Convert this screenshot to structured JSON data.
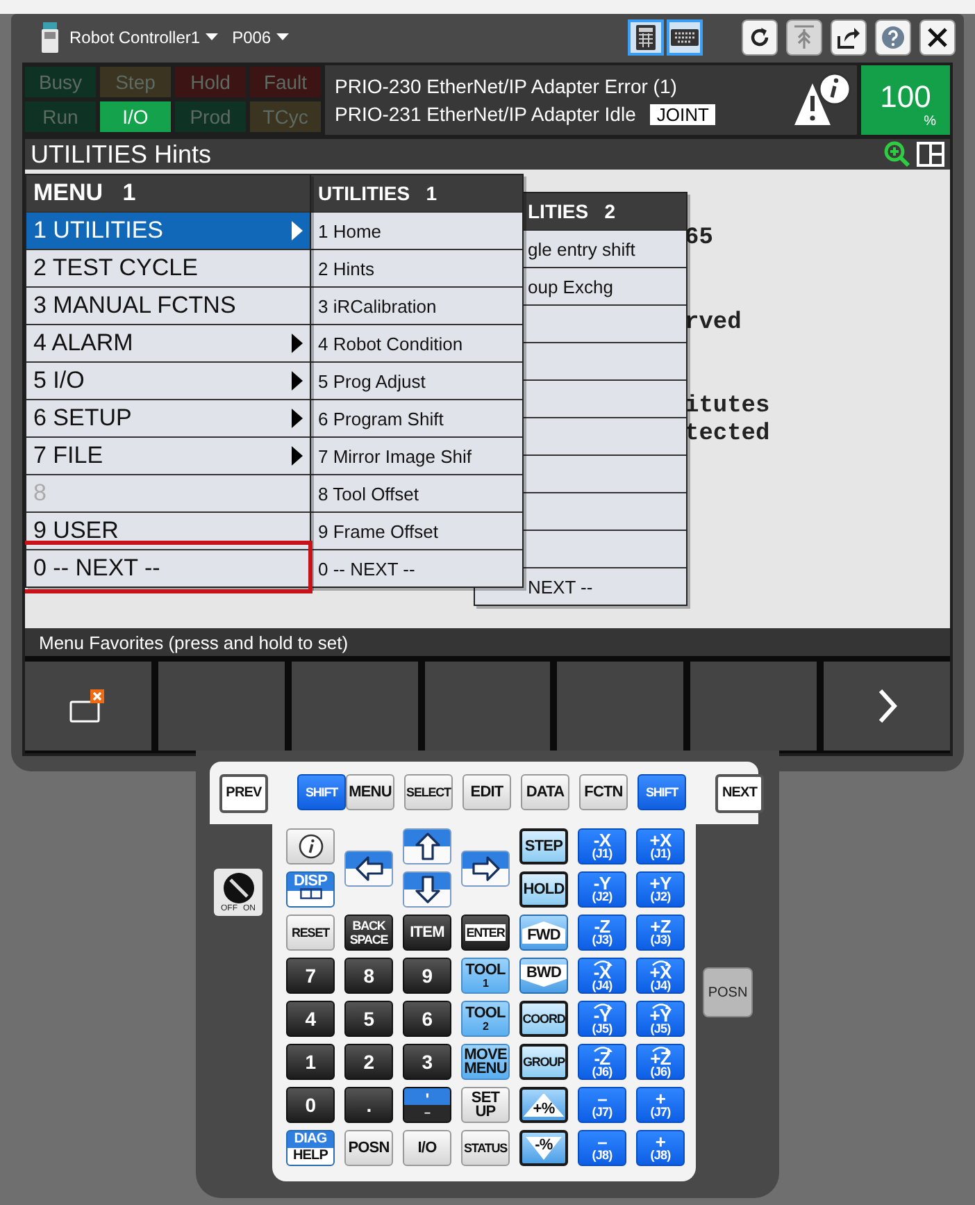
{
  "window": {
    "title": "Robot Controller1",
    "program": "P006"
  },
  "status_flags": [
    {
      "label": "Busy",
      "on": false,
      "color": "#0e3324"
    },
    {
      "label": "Step",
      "on": false,
      "color": "#3a3420"
    },
    {
      "label": "Hold",
      "on": false,
      "color": "#3d1414"
    },
    {
      "label": "Fault",
      "on": false,
      "color": "#3d1414"
    },
    {
      "label": "Run",
      "on": false,
      "color": "#0e3324"
    },
    {
      "label": "I/O",
      "on": true,
      "color": "#15a24c"
    },
    {
      "label": "Prod",
      "on": false,
      "color": "#0e3324"
    },
    {
      "label": "TCyc",
      "on": false,
      "color": "#3a3420"
    }
  ],
  "messages": [
    "PRIO-230 EtherNet/IP Adapter Error (1)",
    "PRIO-231 EtherNet/IP Adapter Idle"
  ],
  "coord_mode": "JOINT",
  "override": {
    "value": "100",
    "unit": "%"
  },
  "screen_title": "UTILITIES Hints",
  "background_lines": [
    "65",
    "rved",
    "itutes",
    "tected"
  ],
  "menus": [
    {
      "title": "MENU",
      "page": "1",
      "items": [
        {
          "label": "1 UTILITIES",
          "selected": true,
          "submenu": true,
          "disabled": false,
          "outlined": false
        },
        {
          "label": "2 TEST CYCLE",
          "selected": false,
          "submenu": false,
          "disabled": false,
          "outlined": false
        },
        {
          "label": "3 MANUAL FCTNS",
          "selected": false,
          "submenu": false,
          "disabled": false,
          "outlined": false
        },
        {
          "label": "4 ALARM",
          "selected": false,
          "submenu": true,
          "disabled": false,
          "outlined": false
        },
        {
          "label": "5 I/O",
          "selected": false,
          "submenu": true,
          "disabled": false,
          "outlined": false
        },
        {
          "label": "6 SETUP",
          "selected": false,
          "submenu": true,
          "disabled": false,
          "outlined": false
        },
        {
          "label": "7 FILE",
          "selected": false,
          "submenu": true,
          "disabled": false,
          "outlined": false
        },
        {
          "label": "8",
          "selected": false,
          "submenu": false,
          "disabled": true,
          "outlined": false
        },
        {
          "label": "9 USER",
          "selected": false,
          "submenu": false,
          "disabled": false,
          "outlined": false
        },
        {
          "label": "0 -- NEXT --",
          "selected": false,
          "submenu": false,
          "disabled": false,
          "outlined": true
        }
      ]
    },
    {
      "title": "UTILITIES",
      "page": "1",
      "items": [
        {
          "label": "1 Home"
        },
        {
          "label": "2 Hints"
        },
        {
          "label": "3 iRCalibration"
        },
        {
          "label": "4 Robot Condition"
        },
        {
          "label": "5 Prog Adjust"
        },
        {
          "label": "6 Program Shift"
        },
        {
          "label": "7 Mirror Image Shif"
        },
        {
          "label": "8 Tool Offset"
        },
        {
          "label": "9 Frame Offset"
        },
        {
          "label": "0 -- NEXT --"
        }
      ]
    },
    {
      "title": "LITIES",
      "page": "2",
      "items": [
        {
          "label": "gle entry shift"
        },
        {
          "label": "oup Exchg"
        },
        {
          "kind": "blank"
        },
        {
          "kind": "blank"
        },
        {
          "kind": "blank"
        },
        {
          "kind": "blank"
        },
        {
          "kind": "blank"
        },
        {
          "kind": "blank"
        },
        {
          "kind": "blank"
        },
        {
          "label": "NEXT --"
        }
      ]
    }
  ],
  "favorites_label": "Menu Favorites (press and hold to set)",
  "softkeys": [
    {
      "kind": "window_close"
    },
    {
      "kind": "blank"
    },
    {
      "kind": "blank"
    },
    {
      "kind": "blank"
    },
    {
      "kind": "blank"
    },
    {
      "kind": "blank"
    },
    {
      "kind": "next"
    }
  ],
  "keypad": {
    "top_keys": [
      {
        "label": "PREV",
        "kind": "side"
      },
      {
        "label": "SHIFT",
        "kind": "shift"
      },
      {
        "label": "MENU",
        "kind": "gray"
      },
      {
        "label": "SELECT",
        "kind": "gray"
      },
      {
        "label": "EDIT",
        "kind": "gray"
      },
      {
        "label": "DATA",
        "kind": "gray"
      },
      {
        "label": "FCTN",
        "kind": "gray"
      },
      {
        "label": "SHIFT",
        "kind": "shift"
      },
      {
        "label": "NEXT",
        "kind": "side"
      }
    ],
    "keys": [
      {
        "kind": "info"
      },
      {
        "kind": "arrow_left"
      },
      {
        "kind": "arrow_up"
      },
      {
        "kind": "arrow_right"
      },
      {
        "label": "STEP",
        "kind": "framed"
      },
      {
        "label": "-X",
        "sub": "(J1)",
        "kind": "jog"
      },
      {
        "label": "+X",
        "sub": "(J1)",
        "kind": "jog"
      },
      {
        "label": "DISP",
        "kind": "disp"
      },
      {
        "kind": "arrow_down"
      },
      {
        "label": "HOLD",
        "kind": "framed"
      },
      {
        "label": "-Y",
        "sub": "(J2)",
        "kind": "jog"
      },
      {
        "label": "+Y",
        "sub": "(J2)",
        "kind": "jog"
      },
      {
        "label": "RESET",
        "kind": "gray"
      },
      {
        "label": "BACK\nSPACE",
        "kind": "dark"
      },
      {
        "label": "ITEM",
        "kind": "dark"
      },
      {
        "label": "ENTER",
        "kind": "enter"
      },
      {
        "label": "FWD",
        "kind": "fwd"
      },
      {
        "label": "-Z",
        "sub": "(J3)",
        "kind": "jog"
      },
      {
        "label": "+Z",
        "sub": "(J3)",
        "kind": "jog"
      },
      {
        "label": "7",
        "kind": "number"
      },
      {
        "label": "8",
        "kind": "number"
      },
      {
        "label": "9",
        "kind": "number"
      },
      {
        "label": "TOOL",
        "sub": "1",
        "kind": "tool"
      },
      {
        "label": "BWD",
        "kind": "bwd"
      },
      {
        "label": "-X",
        "sub": "(J4)",
        "kind": "jog_rot"
      },
      {
        "label": "+X",
        "sub": "(J4)",
        "kind": "jog_rot"
      },
      {
        "label": "4",
        "kind": "number"
      },
      {
        "label": "5",
        "kind": "number"
      },
      {
        "label": "6",
        "kind": "number"
      },
      {
        "label": "TOOL",
        "sub": "2",
        "kind": "tool"
      },
      {
        "label": "COORD",
        "kind": "framed"
      },
      {
        "label": "-Y",
        "sub": "(J5)",
        "kind": "jog_rot"
      },
      {
        "label": "+Y",
        "sub": "(J5)",
        "kind": "jog_rot"
      },
      {
        "label": "1",
        "kind": "number"
      },
      {
        "label": "2",
        "kind": "number"
      },
      {
        "label": "3",
        "kind": "number"
      },
      {
        "label": "MOVE\nMENU",
        "kind": "tool"
      },
      {
        "label": "GROUP",
        "kind": "framed"
      },
      {
        "label": "-Z",
        "sub": "(J6)",
        "kind": "jog_rot"
      },
      {
        "label": "+Z",
        "sub": "(J6)",
        "kind": "jog_rot"
      },
      {
        "label": "0",
        "kind": "number"
      },
      {
        "label": ".",
        "kind": "number"
      },
      {
        "label": "ʹ",
        "sub": "–",
        "kind": "split"
      },
      {
        "label": "SET\nUP",
        "kind": "gray"
      },
      {
        "label": "+%",
        "kind": "plus_pct"
      },
      {
        "label": "–",
        "sub": "(J7)",
        "kind": "jog"
      },
      {
        "label": "+",
        "sub": "(J7)",
        "kind": "jog"
      },
      {
        "label": "DIAG",
        "sub": "HELP",
        "kind": "diag"
      },
      {
        "label": "POSN",
        "kind": "gray"
      },
      {
        "label": "I/O",
        "kind": "gray"
      },
      {
        "label": "STATUS",
        "kind": "gray"
      },
      {
        "label": "-%",
        "kind": "minus_pct"
      },
      {
        "label": "–",
        "sub": "(J8)",
        "kind": "jog"
      },
      {
        "label": "+",
        "sub": "(J8)",
        "kind": "jog"
      }
    ],
    "key_switch": {
      "labels": [
        "OFF",
        "ON"
      ],
      "on": false
    },
    "side_key": "POSN"
  }
}
